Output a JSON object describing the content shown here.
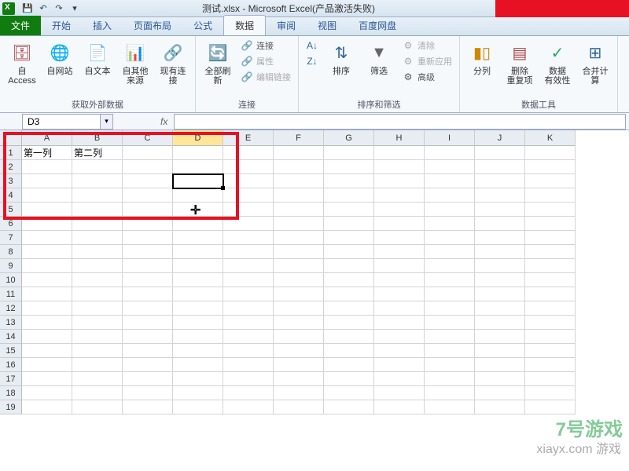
{
  "title": "测试.xlsx - Microsoft Excel(产品激活失败)",
  "qat": {
    "save": "💾",
    "undo": "↶",
    "redo": "↷"
  },
  "tabs": {
    "file": "文件",
    "items": [
      "开始",
      "插入",
      "页面布局",
      "公式",
      "数据",
      "审阅",
      "视图",
      "百度网盘"
    ],
    "active_index": 4
  },
  "ribbon": {
    "group1": {
      "label": "获取外部数据",
      "btns": [
        {
          "label": "自 Access",
          "icon": "🗄"
        },
        {
          "label": "自网站",
          "icon": "🌐"
        },
        {
          "label": "自文本",
          "icon": "📄"
        },
        {
          "label": "自其他来源",
          "icon": "📊"
        },
        {
          "label": "现有连接",
          "icon": "🔗"
        }
      ]
    },
    "group2": {
      "label": "连接",
      "refresh": "全部刷新",
      "items": [
        "连接",
        "属性",
        "编辑链接"
      ]
    },
    "group3": {
      "label": "排序和筛选",
      "sort_az": "A↓Z",
      "sort_za": "Z↓A",
      "sort": "排序",
      "filter": "筛选",
      "items": [
        "清除",
        "重新应用",
        "高级"
      ]
    },
    "group4": {
      "label": "数据工具",
      "btns": [
        {
          "label": "分列",
          "icon": "▮▯"
        },
        {
          "label": "删除\n重复项",
          "icon": "▤"
        },
        {
          "label": "数据\n有效性",
          "icon": "✓"
        },
        {
          "label": "合并计算",
          "icon": "⊞"
        }
      ]
    }
  },
  "name_box": "D3",
  "fx": "fx",
  "columns": [
    "A",
    "B",
    "C",
    "D",
    "E",
    "F",
    "G",
    "H",
    "I",
    "J",
    "K"
  ],
  "selected_col": "D",
  "rows": 19,
  "cells": {
    "A1": "第一列",
    "B1": "第二列"
  },
  "selected_cell": "D3",
  "watermark": "7号游戏",
  "watermark_sub": "xiayx.com 游戏"
}
